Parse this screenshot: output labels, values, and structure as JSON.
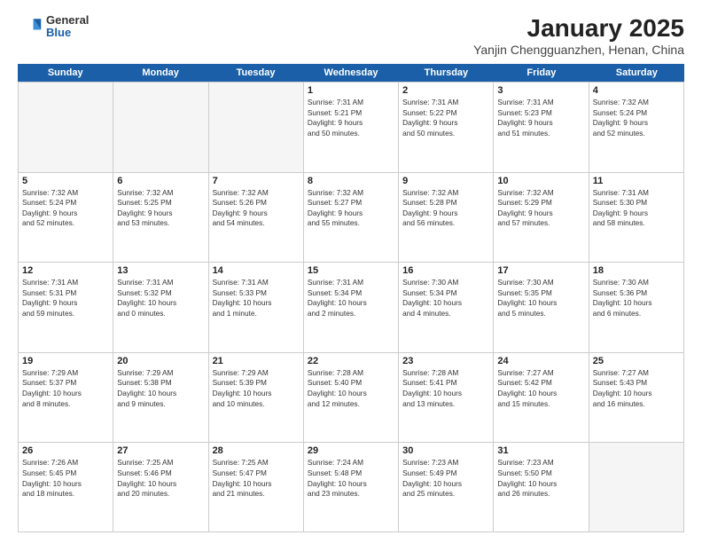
{
  "header": {
    "logo_general": "General",
    "logo_blue": "Blue",
    "title": "January 2025",
    "subtitle": "Yanjin Chengguanzhen, Henan, China"
  },
  "weekdays": [
    "Sunday",
    "Monday",
    "Tuesday",
    "Wednesday",
    "Thursday",
    "Friday",
    "Saturday"
  ],
  "rows": [
    [
      {
        "day": "",
        "info": ""
      },
      {
        "day": "",
        "info": ""
      },
      {
        "day": "",
        "info": ""
      },
      {
        "day": "1",
        "info": "Sunrise: 7:31 AM\nSunset: 5:21 PM\nDaylight: 9 hours\nand 50 minutes."
      },
      {
        "day": "2",
        "info": "Sunrise: 7:31 AM\nSunset: 5:22 PM\nDaylight: 9 hours\nand 50 minutes."
      },
      {
        "day": "3",
        "info": "Sunrise: 7:31 AM\nSunset: 5:23 PM\nDaylight: 9 hours\nand 51 minutes."
      },
      {
        "day": "4",
        "info": "Sunrise: 7:32 AM\nSunset: 5:24 PM\nDaylight: 9 hours\nand 52 minutes."
      }
    ],
    [
      {
        "day": "5",
        "info": "Sunrise: 7:32 AM\nSunset: 5:24 PM\nDaylight: 9 hours\nand 52 minutes."
      },
      {
        "day": "6",
        "info": "Sunrise: 7:32 AM\nSunset: 5:25 PM\nDaylight: 9 hours\nand 53 minutes."
      },
      {
        "day": "7",
        "info": "Sunrise: 7:32 AM\nSunset: 5:26 PM\nDaylight: 9 hours\nand 54 minutes."
      },
      {
        "day": "8",
        "info": "Sunrise: 7:32 AM\nSunset: 5:27 PM\nDaylight: 9 hours\nand 55 minutes."
      },
      {
        "day": "9",
        "info": "Sunrise: 7:32 AM\nSunset: 5:28 PM\nDaylight: 9 hours\nand 56 minutes."
      },
      {
        "day": "10",
        "info": "Sunrise: 7:32 AM\nSunset: 5:29 PM\nDaylight: 9 hours\nand 57 minutes."
      },
      {
        "day": "11",
        "info": "Sunrise: 7:31 AM\nSunset: 5:30 PM\nDaylight: 9 hours\nand 58 minutes."
      }
    ],
    [
      {
        "day": "12",
        "info": "Sunrise: 7:31 AM\nSunset: 5:31 PM\nDaylight: 9 hours\nand 59 minutes."
      },
      {
        "day": "13",
        "info": "Sunrise: 7:31 AM\nSunset: 5:32 PM\nDaylight: 10 hours\nand 0 minutes."
      },
      {
        "day": "14",
        "info": "Sunrise: 7:31 AM\nSunset: 5:33 PM\nDaylight: 10 hours\nand 1 minute."
      },
      {
        "day": "15",
        "info": "Sunrise: 7:31 AM\nSunset: 5:34 PM\nDaylight: 10 hours\nand 2 minutes."
      },
      {
        "day": "16",
        "info": "Sunrise: 7:30 AM\nSunset: 5:34 PM\nDaylight: 10 hours\nand 4 minutes."
      },
      {
        "day": "17",
        "info": "Sunrise: 7:30 AM\nSunset: 5:35 PM\nDaylight: 10 hours\nand 5 minutes."
      },
      {
        "day": "18",
        "info": "Sunrise: 7:30 AM\nSunset: 5:36 PM\nDaylight: 10 hours\nand 6 minutes."
      }
    ],
    [
      {
        "day": "19",
        "info": "Sunrise: 7:29 AM\nSunset: 5:37 PM\nDaylight: 10 hours\nand 8 minutes."
      },
      {
        "day": "20",
        "info": "Sunrise: 7:29 AM\nSunset: 5:38 PM\nDaylight: 10 hours\nand 9 minutes."
      },
      {
        "day": "21",
        "info": "Sunrise: 7:29 AM\nSunset: 5:39 PM\nDaylight: 10 hours\nand 10 minutes."
      },
      {
        "day": "22",
        "info": "Sunrise: 7:28 AM\nSunset: 5:40 PM\nDaylight: 10 hours\nand 12 minutes."
      },
      {
        "day": "23",
        "info": "Sunrise: 7:28 AM\nSunset: 5:41 PM\nDaylight: 10 hours\nand 13 minutes."
      },
      {
        "day": "24",
        "info": "Sunrise: 7:27 AM\nSunset: 5:42 PM\nDaylight: 10 hours\nand 15 minutes."
      },
      {
        "day": "25",
        "info": "Sunrise: 7:27 AM\nSunset: 5:43 PM\nDaylight: 10 hours\nand 16 minutes."
      }
    ],
    [
      {
        "day": "26",
        "info": "Sunrise: 7:26 AM\nSunset: 5:45 PM\nDaylight: 10 hours\nand 18 minutes."
      },
      {
        "day": "27",
        "info": "Sunrise: 7:25 AM\nSunset: 5:46 PM\nDaylight: 10 hours\nand 20 minutes."
      },
      {
        "day": "28",
        "info": "Sunrise: 7:25 AM\nSunset: 5:47 PM\nDaylight: 10 hours\nand 21 minutes."
      },
      {
        "day": "29",
        "info": "Sunrise: 7:24 AM\nSunset: 5:48 PM\nDaylight: 10 hours\nand 23 minutes."
      },
      {
        "day": "30",
        "info": "Sunrise: 7:23 AM\nSunset: 5:49 PM\nDaylight: 10 hours\nand 25 minutes."
      },
      {
        "day": "31",
        "info": "Sunrise: 7:23 AM\nSunset: 5:50 PM\nDaylight: 10 hours\nand 26 minutes."
      },
      {
        "day": "",
        "info": ""
      }
    ]
  ]
}
